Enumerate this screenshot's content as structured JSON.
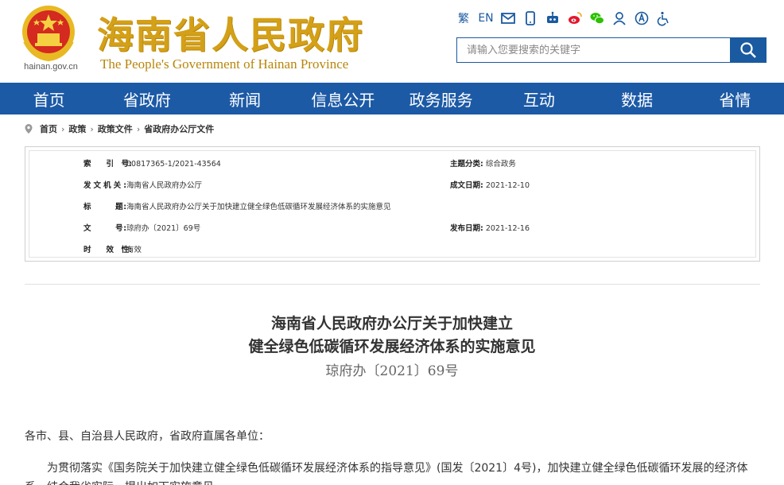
{
  "header": {
    "title": "海南省人民政府",
    "subtitle": "The People's Government  of Hainan Province",
    "domain": "hainan.gov.cn",
    "tools": {
      "traditional": "繁",
      "english": "EN"
    },
    "search_placeholder": "请输入您要搜索的关键字"
  },
  "nav": [
    "首页",
    "省政府",
    "新闻",
    "信息公开",
    "政务服务",
    "互动",
    "数据",
    "省情"
  ],
  "breadcrumb": [
    "首页",
    "政策",
    "政策文件",
    "省政府办公厅文件"
  ],
  "meta": {
    "index_label": "索　　引　号:",
    "index_value": "00817365-1/2021-43564",
    "category_label": "主题分类:",
    "category_value": "综合政务",
    "issuer_label": "发文机关:",
    "issuer_value": "海南省人民政府办公厅",
    "date_label": "成文日期:",
    "date_value": "2021-12-10",
    "title_label": "标　　　题:",
    "title_value": "海南省人民政府办公厅关于加快建立健全绿色低碳循环发展经济体系的实施意见",
    "docno_label": "文　　　号:",
    "docno_value": "琼府办〔2021〕69号",
    "pub_label": "发布日期:",
    "pub_value": "2021-12-16",
    "valid_label": "时　　效　性:",
    "valid_value": "有效"
  },
  "article": {
    "title_line1": "海南省人民政府办公厅关于加快建立",
    "title_line2": "健全绿色低碳循环发展经济体系的实施意见",
    "doc_number": "琼府办〔2021〕69号",
    "salutation": "各市、县、自治县人民政府，省政府直属各单位：",
    "para1": "为贯彻落实《国务院关于加快建立健全绿色低碳循环发展经济体系的指导意见》(国发〔2021〕4号)，加快建立健全绿色低碳循环发展的经济体系，结合我省实际，提出如下实施意见。"
  },
  "colors": {
    "nav_bg": "#1c5aa6",
    "title_gold": "#d4a017",
    "accent": "#1a5aa0"
  }
}
